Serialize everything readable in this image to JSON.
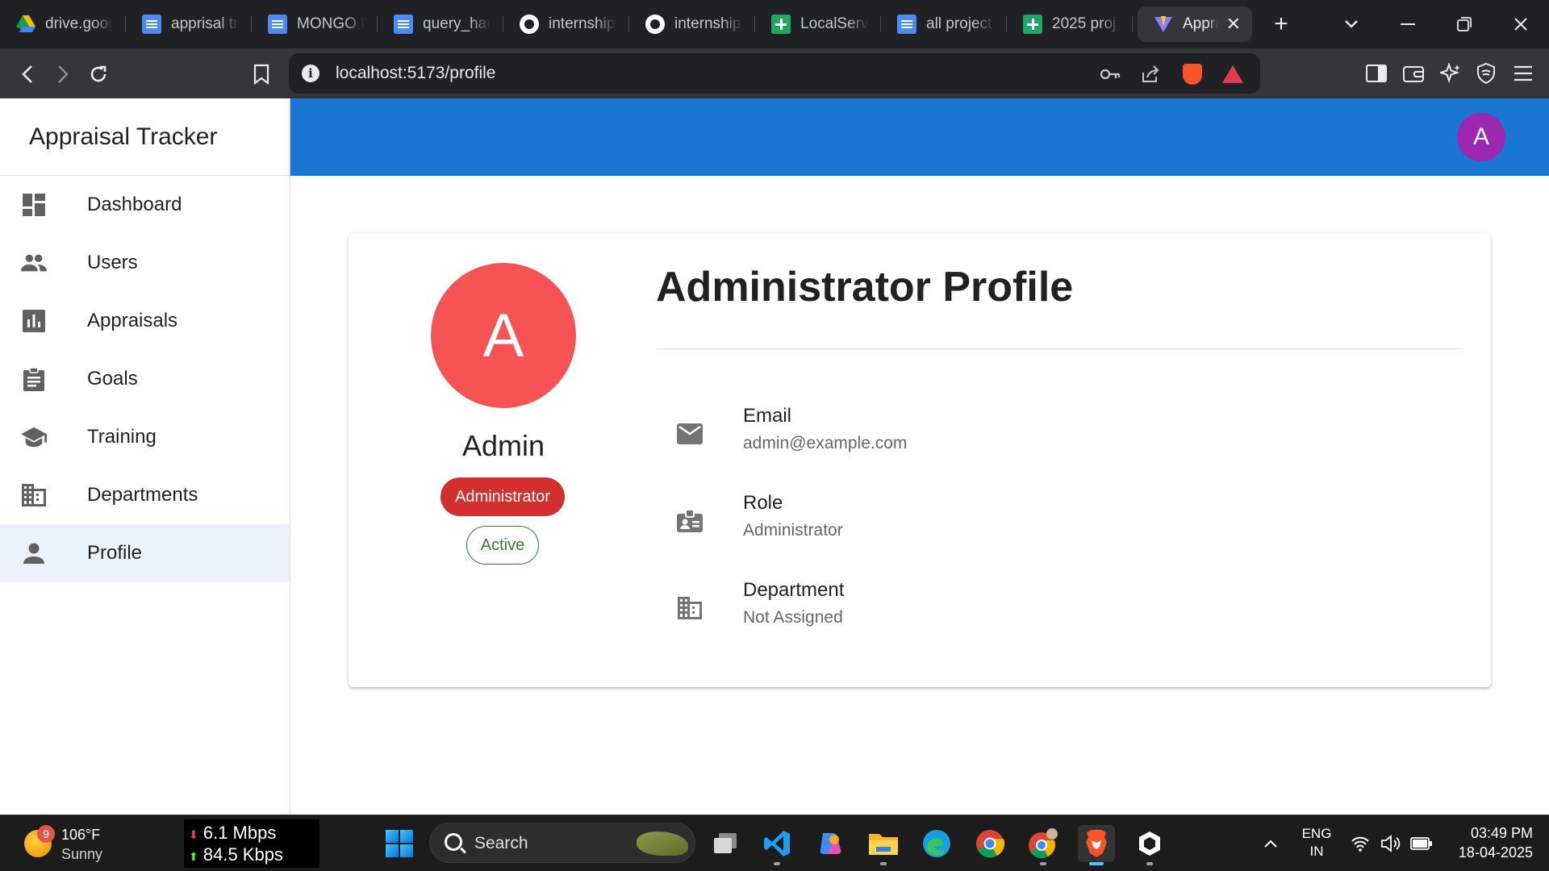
{
  "browser": {
    "tabs": [
      {
        "label": "drive.goog",
        "icon": "google-drive-icon"
      },
      {
        "label": "apprisal tr",
        "icon": "google-docs-icon"
      },
      {
        "label": "MONGO D",
        "icon": "google-docs-icon"
      },
      {
        "label": "query_har",
        "icon": "google-docs-icon"
      },
      {
        "label": "internship",
        "icon": "github-icon"
      },
      {
        "label": "internship",
        "icon": "github-icon"
      },
      {
        "label": "LocalServi",
        "icon": "google-sheets-icon"
      },
      {
        "label": "all project",
        "icon": "google-docs-icon"
      },
      {
        "label": "2025 proj",
        "icon": "google-sheets-icon"
      }
    ],
    "active_tab": {
      "label": "Appra",
      "icon": "vite-icon"
    },
    "url": "localhost:5173/profile"
  },
  "app": {
    "title": "Appraisal Tracker",
    "user_initial": "A",
    "brand_color": "#1976d2"
  },
  "sidebar": {
    "items": [
      {
        "label": "Dashboard",
        "icon": "dashboard-icon"
      },
      {
        "label": "Users",
        "icon": "users-icon"
      },
      {
        "label": "Appraisals",
        "icon": "bar-chart-icon"
      },
      {
        "label": "Goals",
        "icon": "clipboard-icon"
      },
      {
        "label": "Training",
        "icon": "graduation-cap-icon"
      },
      {
        "label": "Departments",
        "icon": "building-icon"
      },
      {
        "label": "Profile",
        "icon": "person-icon",
        "selected": true
      }
    ]
  },
  "profile": {
    "avatar_initial": "A",
    "name": "Admin",
    "role_chip": "Administrator",
    "status_chip": "Active",
    "title": "Administrator Profile",
    "details": [
      {
        "label": "Email",
        "value": "admin@example.com",
        "icon": "mail-icon"
      },
      {
        "label": "Role",
        "value": "Administrator",
        "icon": "badge-icon"
      },
      {
        "label": "Department",
        "value": "Not Assigned",
        "icon": "building-icon"
      }
    ]
  },
  "taskbar": {
    "weather_temp": "106°F",
    "weather_cond": "Sunny",
    "weather_badge": "9",
    "net_down": "6.1 Mbps",
    "net_up": "84.5 Kbps",
    "search_placeholder": "Search",
    "lang_top": "ENG",
    "lang_bottom": "IN",
    "time": "03:49 PM",
    "date": "18-04-2025"
  }
}
